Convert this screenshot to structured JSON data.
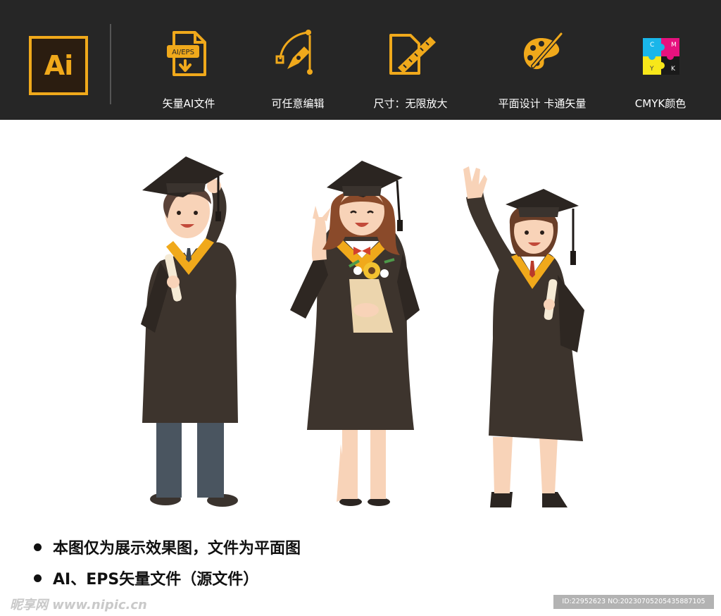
{
  "header": {
    "logo_text": "Ai",
    "features": [
      {
        "label": "矢量AI文件",
        "icon": "ai-eps-file-icon",
        "badge": "AI/EPS"
      },
      {
        "label": "可任意编辑",
        "icon": "pen-tool-icon"
      },
      {
        "label": "尺寸：无限放大",
        "icon": "ruler-file-icon"
      },
      {
        "label": "平面设计  卡通矢量",
        "icon": "palette-brush-icon"
      },
      {
        "label": "CMYK颜色",
        "icon": "cmyk-puzzle-icon",
        "cmyk_letters": [
          "C",
          "M",
          "Y",
          "K"
        ]
      }
    ],
    "accent_color": "#f0a91b"
  },
  "illustration": {
    "subject": "three cartoon graduates in black gowns with yellow stoles"
  },
  "notes": [
    "本图仅为展示效果图，文件为平面图",
    "AI、EPS矢量文件（源文件）"
  ],
  "watermark": {
    "text": "昵享网 www.nipic.cn",
    "id_text": "ID:22952623 NO:20230705205435887105"
  }
}
